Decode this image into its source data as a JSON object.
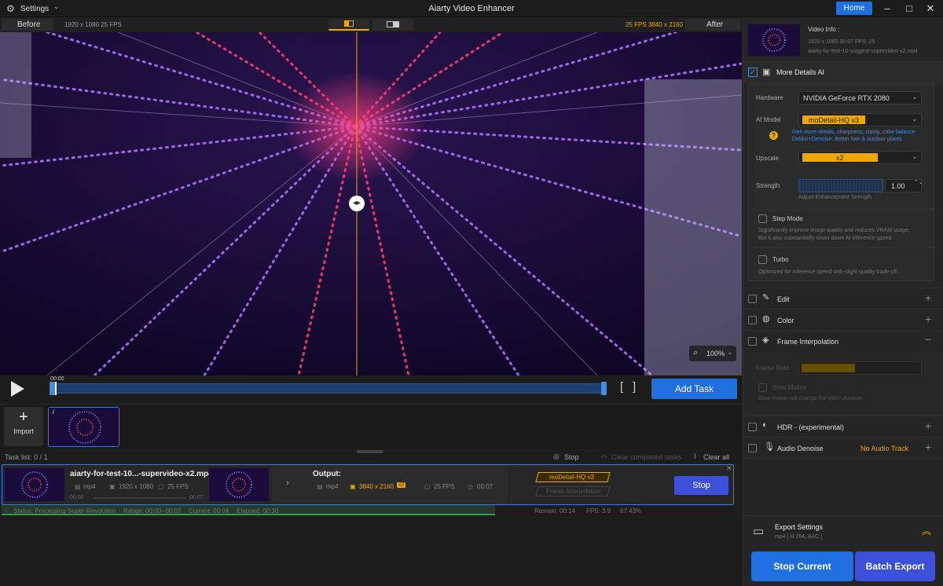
{
  "titlebar": {
    "settings_label": "Settings",
    "app_title": "Aiarty Video Enhancer",
    "home_label": "Home"
  },
  "preview_header": {
    "before_label": "Before",
    "before_info": "1920 x 1080  25 FPS",
    "after_info": "25 FPS  3840 x 2160",
    "after_label": "After"
  },
  "preview": {
    "zoom": "100%"
  },
  "scrubber": {
    "time": "00:00",
    "add_task_label": "Add Task"
  },
  "bin": {
    "import_label": "Import"
  },
  "tasklist": {
    "count": "Task list: 0 / 1",
    "stop_label": "Stop",
    "clear_completed_label": "Clear completed tasks",
    "clear_all_label": "Clear all"
  },
  "task": {
    "filename": "aiarty-for-test-10...-supervideo-x2.mp4",
    "src_format": "mp4",
    "src_res": "1920 x 1080",
    "src_fps": "25 FPS",
    "time_start": "00:00",
    "time_end": "00:07",
    "output_label": "Output:",
    "out_format": "mp4",
    "out_res": "3840 x 2160",
    "out_scale": "x2",
    "out_fps": "25 FPS",
    "out_duration": "00:07",
    "model_tag": "moDetail-HQ  v3",
    "interp_tag": "Frame Interpolation",
    "stop_label": "Stop",
    "progress_fraction": 0.6743
  },
  "status": {
    "status": "Status: Processing Super Resolution",
    "range": "Range: 00:00--00:07",
    "current": "Current: 00:04",
    "elapsed": "Elapsed: 00:30",
    "remain": "Remain: 00:14",
    "fps": "FPS: 3.9",
    "percent": "67.43%"
  },
  "right_panel": {
    "video_info_label": "Video Info :",
    "video_meta": "1920 x 1080   00:07    FPS: 25",
    "video_file": "aiarty-for-test-10-suggest-supervideo-x2.mp4",
    "more_details_label": "More Details AI",
    "hardware_label": "Hardware",
    "hardware_value": "NVIDIA GeForce RTX 2080",
    "ai_model_label": "AI Model",
    "ai_model_value": "moDetail-HQ  v3",
    "ai_model_desc_1": "Gen more details, sharpness, clarity, color balance",
    "ai_model_desc_2": "Deblur+Denoise. Better hair & outdoor plants",
    "upscale_label": "Upscale",
    "upscale_value": "x2",
    "strength_label": "Strength",
    "strength_value": "1.00",
    "strength_hint": "Adjust Enhancement Strength",
    "step_mode_label": "Step Mode",
    "step_mode_desc_1": "Significantly improve image quality and reduces VRAM usage,",
    "step_mode_desc_2": "But it also substantially slows down AI inference speed.",
    "turbo_label": "Turbo",
    "turbo_desc": "Optimized for inference speed with slight quality trade-off.",
    "edit_label": "Edit",
    "color_label": "Color",
    "frame_interp_label": "Frame Interpolation",
    "frame_rate_label": "Frame Rate",
    "slow_motion_label": "Slow Motion",
    "slow_motion_desc": "Slow motion will change the video duration.",
    "hdr_label": "HDR - (experimental)",
    "audio_denoise_label": "Audio Denoise",
    "no_audio_label": "No Audio Track",
    "export_settings_label": "Export Settings",
    "export_format": "mp4 [ H.264, AAC ]",
    "stop_current_label": "Stop Current",
    "batch_export_label": "Batch Export"
  },
  "colors": {
    "accent_blue": "#1f6fe0",
    "model_orange": "#f0a800",
    "info_blue": "#3b8eea"
  }
}
